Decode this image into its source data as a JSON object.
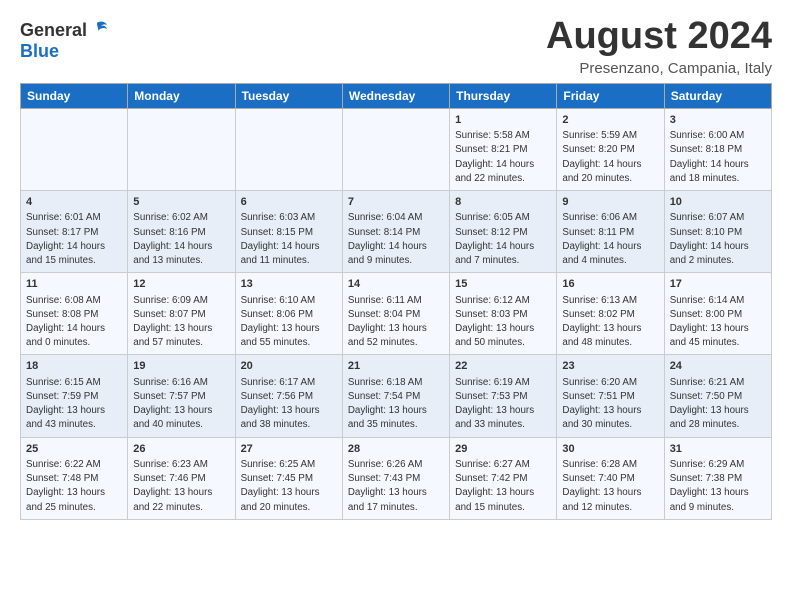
{
  "header": {
    "logo_general": "General",
    "logo_blue": "Blue",
    "title": "August 2024",
    "subtitle": "Presenzano, Campania, Italy"
  },
  "weekdays": [
    "Sunday",
    "Monday",
    "Tuesday",
    "Wednesday",
    "Thursday",
    "Friday",
    "Saturday"
  ],
  "weeks": [
    [
      {
        "day": "",
        "info": ""
      },
      {
        "day": "",
        "info": ""
      },
      {
        "day": "",
        "info": ""
      },
      {
        "day": "",
        "info": ""
      },
      {
        "day": "1",
        "info": "Sunrise: 5:58 AM\nSunset: 8:21 PM\nDaylight: 14 hours\nand 22 minutes."
      },
      {
        "day": "2",
        "info": "Sunrise: 5:59 AM\nSunset: 8:20 PM\nDaylight: 14 hours\nand 20 minutes."
      },
      {
        "day": "3",
        "info": "Sunrise: 6:00 AM\nSunset: 8:18 PM\nDaylight: 14 hours\nand 18 minutes."
      }
    ],
    [
      {
        "day": "4",
        "info": "Sunrise: 6:01 AM\nSunset: 8:17 PM\nDaylight: 14 hours\nand 15 minutes."
      },
      {
        "day": "5",
        "info": "Sunrise: 6:02 AM\nSunset: 8:16 PM\nDaylight: 14 hours\nand 13 minutes."
      },
      {
        "day": "6",
        "info": "Sunrise: 6:03 AM\nSunset: 8:15 PM\nDaylight: 14 hours\nand 11 minutes."
      },
      {
        "day": "7",
        "info": "Sunrise: 6:04 AM\nSunset: 8:14 PM\nDaylight: 14 hours\nand 9 minutes."
      },
      {
        "day": "8",
        "info": "Sunrise: 6:05 AM\nSunset: 8:12 PM\nDaylight: 14 hours\nand 7 minutes."
      },
      {
        "day": "9",
        "info": "Sunrise: 6:06 AM\nSunset: 8:11 PM\nDaylight: 14 hours\nand 4 minutes."
      },
      {
        "day": "10",
        "info": "Sunrise: 6:07 AM\nSunset: 8:10 PM\nDaylight: 14 hours\nand 2 minutes."
      }
    ],
    [
      {
        "day": "11",
        "info": "Sunrise: 6:08 AM\nSunset: 8:08 PM\nDaylight: 14 hours\nand 0 minutes."
      },
      {
        "day": "12",
        "info": "Sunrise: 6:09 AM\nSunset: 8:07 PM\nDaylight: 13 hours\nand 57 minutes."
      },
      {
        "day": "13",
        "info": "Sunrise: 6:10 AM\nSunset: 8:06 PM\nDaylight: 13 hours\nand 55 minutes."
      },
      {
        "day": "14",
        "info": "Sunrise: 6:11 AM\nSunset: 8:04 PM\nDaylight: 13 hours\nand 52 minutes."
      },
      {
        "day": "15",
        "info": "Sunrise: 6:12 AM\nSunset: 8:03 PM\nDaylight: 13 hours\nand 50 minutes."
      },
      {
        "day": "16",
        "info": "Sunrise: 6:13 AM\nSunset: 8:02 PM\nDaylight: 13 hours\nand 48 minutes."
      },
      {
        "day": "17",
        "info": "Sunrise: 6:14 AM\nSunset: 8:00 PM\nDaylight: 13 hours\nand 45 minutes."
      }
    ],
    [
      {
        "day": "18",
        "info": "Sunrise: 6:15 AM\nSunset: 7:59 PM\nDaylight: 13 hours\nand 43 minutes."
      },
      {
        "day": "19",
        "info": "Sunrise: 6:16 AM\nSunset: 7:57 PM\nDaylight: 13 hours\nand 40 minutes."
      },
      {
        "day": "20",
        "info": "Sunrise: 6:17 AM\nSunset: 7:56 PM\nDaylight: 13 hours\nand 38 minutes."
      },
      {
        "day": "21",
        "info": "Sunrise: 6:18 AM\nSunset: 7:54 PM\nDaylight: 13 hours\nand 35 minutes."
      },
      {
        "day": "22",
        "info": "Sunrise: 6:19 AM\nSunset: 7:53 PM\nDaylight: 13 hours\nand 33 minutes."
      },
      {
        "day": "23",
        "info": "Sunrise: 6:20 AM\nSunset: 7:51 PM\nDaylight: 13 hours\nand 30 minutes."
      },
      {
        "day": "24",
        "info": "Sunrise: 6:21 AM\nSunset: 7:50 PM\nDaylight: 13 hours\nand 28 minutes."
      }
    ],
    [
      {
        "day": "25",
        "info": "Sunrise: 6:22 AM\nSunset: 7:48 PM\nDaylight: 13 hours\nand 25 minutes."
      },
      {
        "day": "26",
        "info": "Sunrise: 6:23 AM\nSunset: 7:46 PM\nDaylight: 13 hours\nand 22 minutes."
      },
      {
        "day": "27",
        "info": "Sunrise: 6:25 AM\nSunset: 7:45 PM\nDaylight: 13 hours\nand 20 minutes."
      },
      {
        "day": "28",
        "info": "Sunrise: 6:26 AM\nSunset: 7:43 PM\nDaylight: 13 hours\nand 17 minutes."
      },
      {
        "day": "29",
        "info": "Sunrise: 6:27 AM\nSunset: 7:42 PM\nDaylight: 13 hours\nand 15 minutes."
      },
      {
        "day": "30",
        "info": "Sunrise: 6:28 AM\nSunset: 7:40 PM\nDaylight: 13 hours\nand 12 minutes."
      },
      {
        "day": "31",
        "info": "Sunrise: 6:29 AM\nSunset: 7:38 PM\nDaylight: 13 hours\nand 9 minutes."
      }
    ]
  ]
}
